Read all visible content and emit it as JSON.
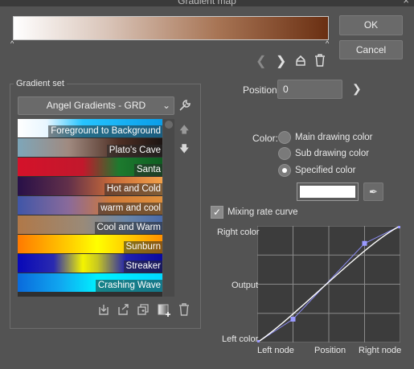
{
  "window": {
    "title": "Gradient map",
    "close_icon": "close-icon"
  },
  "gradient_bar": {
    "colors": [
      "#ffffff",
      "#d9c4b8",
      "#a77454",
      "#6a2f12"
    ],
    "stop_marker": "^"
  },
  "buttons": {
    "ok": "OK",
    "cancel": "Cancel"
  },
  "nav_icons": [
    "chevron-left-icon",
    "chevron-right-icon",
    "flip-icon",
    "trash-icon"
  ],
  "gradient_set": {
    "group_label": "Gradient set",
    "selected": "Angel Gradients - GRD",
    "items": [
      {
        "label": "Foreground to Background",
        "gradient": "linear-gradient(to right, #ffffff 0%, #e8f6ff 20%, #26c4ff 45%, #0a9de8 100%)"
      },
      {
        "label": "Plato's Cave",
        "gradient": "linear-gradient(to right, #7ea6b9 0%, #a08a80 35%, #4e2f24 70%, #1c1412 100%)"
      },
      {
        "label": "Santa",
        "gradient": "linear-gradient(to right, #d4122a 0%, #c2182c 45%, #1d7a2e 70%, #0f5e22 100%)"
      },
      {
        "label": "Hot and Cold",
        "gradient": "linear-gradient(to right, #281048 0%, #62304a 35%, #c86a38 65%, #f2a048 100%)"
      },
      {
        "label": "warm and cool",
        "gradient": "linear-gradient(to right, #4056a8 0%, #8a6a9a 35%, #d07a38 65%, #e0903c 100%)"
      },
      {
        "label": "Cool and Warm",
        "gradient": "linear-gradient(to right, #b07848 0%, #9a8a78 45%, #6a86a8 75%, #4a6aa8 100%)"
      },
      {
        "label": "Sunburn",
        "gradient": "linear-gradient(to right, #ff7a00 0%, #ffcc00 35%, #ffff00 55%, #ff9000 100%)"
      },
      {
        "label": "Streaker",
        "gradient": "linear-gradient(to right, #0808b8 0%, #2a2ab0 25%, #f4f400 45%, #c8c820 55%, #2020b0 75%, #0a0aa0 100%)"
      },
      {
        "label": "Crashing Wave",
        "gradient": "linear-gradient(to right, #0a6adc 0%, #10a8f0 30%, #00f0ff 55%, #00d8ff 100%)"
      }
    ],
    "side_icons": [
      "arrow-up-icon",
      "arrow-down-icon"
    ],
    "bottom_icons": [
      "import-icon",
      "export-icon",
      "duplicate-icon",
      "add-gradient-icon",
      "trash-icon"
    ]
  },
  "position": {
    "label": "Position:",
    "value": "0"
  },
  "color": {
    "label": "Color:",
    "options": [
      {
        "label": "Main drawing color",
        "selected": false
      },
      {
        "label": "Sub drawing color",
        "selected": false
      },
      {
        "label": "Specified color",
        "selected": true
      }
    ],
    "specified_color": "#ffffff"
  },
  "mixing": {
    "label": "Mixing rate curve",
    "checked": true
  },
  "curve": {
    "y_top": "Right color",
    "y_mid": "Output",
    "y_bottom": "Left color",
    "x_left": "Left node",
    "x_mid": "Position",
    "x_right": "Right node",
    "control_points": [
      [
        0,
        0
      ],
      [
        0.25,
        0.2
      ],
      [
        0.75,
        0.85
      ],
      [
        1,
        1
      ]
    ]
  }
}
